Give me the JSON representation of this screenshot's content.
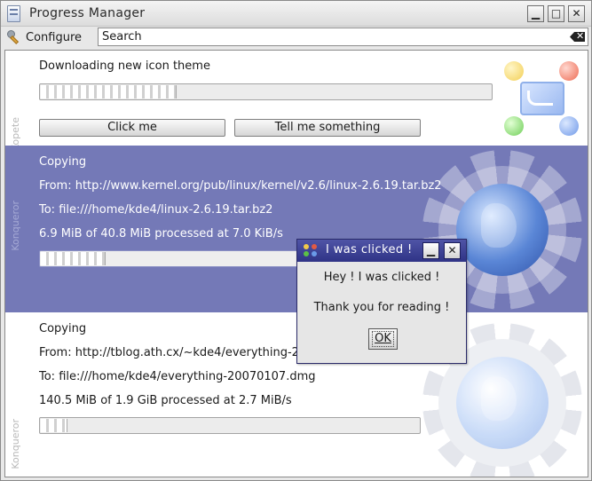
{
  "window": {
    "title": "Progress Manager",
    "minimize_icon": "minimize-icon",
    "maximize_icon": "maximize-icon",
    "close_icon": "close-icon"
  },
  "toolbar": {
    "configure_label": "Configure",
    "configure_icon": "wrench-icon",
    "search_value": "Search",
    "clear_icon": "clear-search-icon"
  },
  "jobs": [
    {
      "app": "Kopete",
      "title": "Downloading new icon theme",
      "progress": 0.3,
      "buttons": [
        "Click me",
        "Tell me something"
      ]
    },
    {
      "app": "Konqueror",
      "title": "Copying",
      "from": "From: http://www.kernel.org/pub/linux/kernel/v2.6/linux-2.6.19.tar.bz2",
      "to": "To: file:///home/kde4/linux-2.6.19.tar.bz2",
      "status": "6.9 MiB of 40.8 MiB processed at 7.0 KiB/s",
      "progress": 0.17,
      "selected": true
    },
    {
      "app": "Konqueror",
      "title": "Copying",
      "from": "From: http://tblog.ath.cx/~kde4/everything-20070107.dmg",
      "to": "To: file:///home/kde4/everything-20070107.dmg",
      "status": "140.5 MiB of 1.9 GiB processed at 2.7 MiB/s",
      "progress": 0.07
    }
  ],
  "dialog": {
    "title": "I was clicked !",
    "message1": "Hey ! I was clicked !",
    "message2": "Thank you for reading !",
    "ok_label": "OK"
  },
  "colors": {
    "selection": "#7479b7",
    "dialog_title": "#3a3e94"
  }
}
